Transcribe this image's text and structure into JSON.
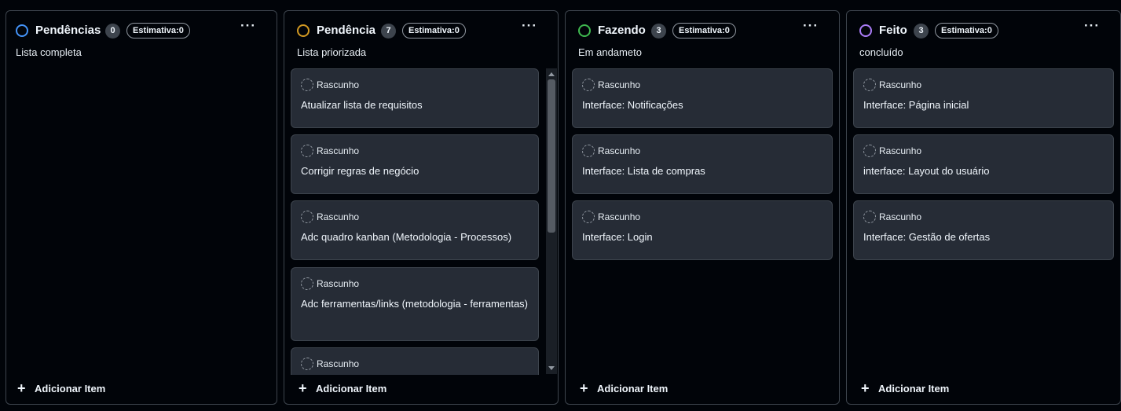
{
  "columns": [
    {
      "title": "Pendências",
      "count": "0",
      "estimate": "Estimativa:0",
      "description": "Lista completa",
      "status_color": "#4493f8",
      "menu_label": "···",
      "add_label": "Adicionar Item",
      "cards": []
    },
    {
      "title": "Pendência",
      "count": "7",
      "estimate": "Estimativa:0",
      "description": "Lista priorizada",
      "status_color": "#d29922",
      "menu_label": "···",
      "add_label": "Adicionar Item",
      "cards": [
        {
          "status": "Rascunho",
          "title": "Atualizar lista de requisitos"
        },
        {
          "status": "Rascunho",
          "title": "Corrigir regras de negócio"
        },
        {
          "status": "Rascunho",
          "title": "Adc quadro kanban (Metodologia - Processos)"
        },
        {
          "status": "Rascunho",
          "title": "Adc ferramentas/links (metodologia - ferramentas)"
        },
        {
          "status": "Rascunho",
          "title": ""
        }
      ]
    },
    {
      "title": "Fazendo",
      "count": "3",
      "estimate": "Estimativa:0",
      "description": "Em andameto",
      "status_color": "#3fb950",
      "menu_label": "···",
      "add_label": "Adicionar Item",
      "cards": [
        {
          "status": "Rascunho",
          "title": "Interface: Notificações"
        },
        {
          "status": "Rascunho",
          "title": "Interface: Lista de compras"
        },
        {
          "status": "Rascunho",
          "title": "Interface: Login"
        }
      ]
    },
    {
      "title": "Feito",
      "count": "3",
      "estimate": "Estimativa:0",
      "description": "concluído",
      "status_color": "#ab7df8",
      "menu_label": "···",
      "add_label": "Adicionar Item",
      "cards": [
        {
          "status": "Rascunho",
          "title": "Interface: Página inicial"
        },
        {
          "status": "Rascunho",
          "title": "interface: Layout do usuário"
        },
        {
          "status": "Rascunho",
          "title": "Interface: Gestão de ofertas"
        }
      ]
    }
  ]
}
